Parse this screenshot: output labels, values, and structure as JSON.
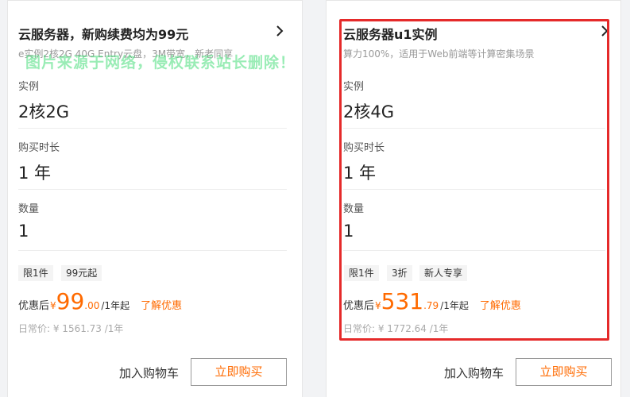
{
  "colors": {
    "accent": "#ff6a00",
    "highlight_border": "#e52a2a",
    "watermark": "#46dc78"
  },
  "cards": [
    {
      "title": "云服务器，新购续费均为99元",
      "description": "e实例2核2G 40G Entry云盘，3M带宽，新老同享",
      "fields": [
        {
          "label": "实例",
          "value": "2核2G"
        },
        {
          "label": "购买时长",
          "value": "1 年"
        },
        {
          "label": "数量",
          "value": "1"
        }
      ],
      "tags": [
        "限1件",
        "99元起"
      ],
      "price_label": "优惠后",
      "currency": "¥",
      "price_integer": "99",
      "price_decimal": ".00",
      "price_unit": "/1年起",
      "promo_link": "了解优惠",
      "regular_price": "日常价: ¥ 1561.73 /1年",
      "add_to_cart": "加入购物车",
      "buy_now": "立即购买"
    },
    {
      "title": "云服务器u1实例",
      "description": "算力100%，适用于Web前端等计算密集场景",
      "fields": [
        {
          "label": "实例",
          "value": "2核4G"
        },
        {
          "label": "购买时长",
          "value": "1 年"
        },
        {
          "label": "数量",
          "value": "1"
        }
      ],
      "tags": [
        "限1件",
        "3折",
        "新人专享"
      ],
      "price_label": "优惠后",
      "currency": "¥",
      "price_integer": "531",
      "price_decimal": ".79",
      "price_unit": "/1年起",
      "promo_link": "了解优惠",
      "regular_price": "日常价: ¥ 1772.64 /1年",
      "add_to_cart": "加入购物车",
      "buy_now": "立即购买"
    }
  ],
  "watermark_text": "图片来源于网络，侵权联系站长删除！"
}
